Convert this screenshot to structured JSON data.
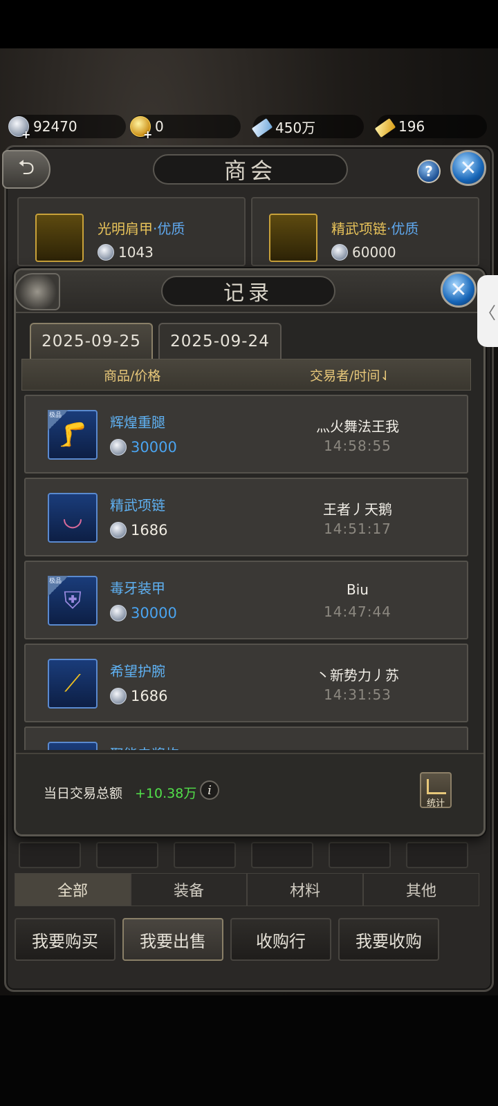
{
  "currencies": [
    {
      "icon": "silver-coin-icon",
      "value": "92470"
    },
    {
      "icon": "gold-coin-icon",
      "value": "0"
    },
    {
      "icon": "blue-ingot-icon",
      "value": "450万"
    },
    {
      "icon": "gold-ingot-icon",
      "value": "196"
    }
  ],
  "shop": {
    "title": "商会",
    "help_label": "?",
    "featured": [
      {
        "name": "光明肩甲",
        "quality": "·优质",
        "price": "1043"
      },
      {
        "name": "精武项链",
        "quality": "·优质",
        "price": "60000"
      }
    ],
    "filter_tabs": [
      "全部",
      "装备",
      "材料",
      "其他"
    ],
    "bottom_nav": [
      "我要购买",
      "我要出售",
      "收购行",
      "我要收购"
    ]
  },
  "record": {
    "title": "记录",
    "date_tabs": [
      "2025-09-25",
      "2025-09-24"
    ],
    "columns": {
      "goods": "商品/价格",
      "trader": "交易者/时间⇃"
    },
    "rows": [
      {
        "name": "辉煌重腿",
        "price": "30000",
        "trader": "灬火舞法王我",
        "time": "14:58:55",
        "badge": "极品"
      },
      {
        "name": "精武项链",
        "price": "1686",
        "trader": "王者丿天鹅",
        "time": "14:51:17",
        "badge": ""
      },
      {
        "name": "毒牙装甲",
        "price": "30000",
        "trader": "Biu",
        "time": "14:47:44",
        "badge": "极品"
      },
      {
        "name": "希望护腕",
        "price": "1686",
        "trader": "丶新势力丿苏",
        "time": "14:31:53",
        "badge": ""
      },
      {
        "name": "聚能电浆炮",
        "price": "",
        "trader": "",
        "time": "",
        "badge": ""
      }
    ],
    "footer": {
      "total_label": "当日交易总额",
      "total_value": "+10.38万",
      "stats_label": "统计",
      "info_label": "i"
    }
  },
  "side_handle": "〈"
}
